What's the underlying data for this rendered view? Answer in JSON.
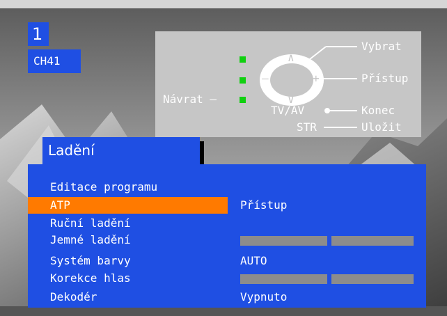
{
  "channel": {
    "number": "1",
    "name": "CH41"
  },
  "help": {
    "select": "Vybrat",
    "access": "Přístup",
    "back": "Návrat –",
    "tvav": "TV/AV",
    "exit": "Konec",
    "str": "STR",
    "save": "Uložit",
    "up_glyph": "∧",
    "down_glyph": "∨",
    "minus_glyph": "–",
    "plus_glyph": "+",
    "indicator_color": "#10d010"
  },
  "menu": {
    "title": "Ladění",
    "selected_color": "#ff7a00",
    "background_color": "#1f4fe3",
    "items": [
      {
        "label": "Editace programu",
        "value": ""
      },
      {
        "label": "ATP",
        "value": "Přístup",
        "selected": true
      },
      {
        "label": "Ruční ladění",
        "value": ""
      },
      {
        "label": "Jemné ladění",
        "value": "",
        "slider": true
      },
      {
        "label": "Systém barvy",
        "value": "AUTO"
      },
      {
        "label": "Korekce hlas",
        "value": "",
        "slider": true
      },
      {
        "label": "Dekodér",
        "value": "Vypnuto"
      }
    ]
  }
}
